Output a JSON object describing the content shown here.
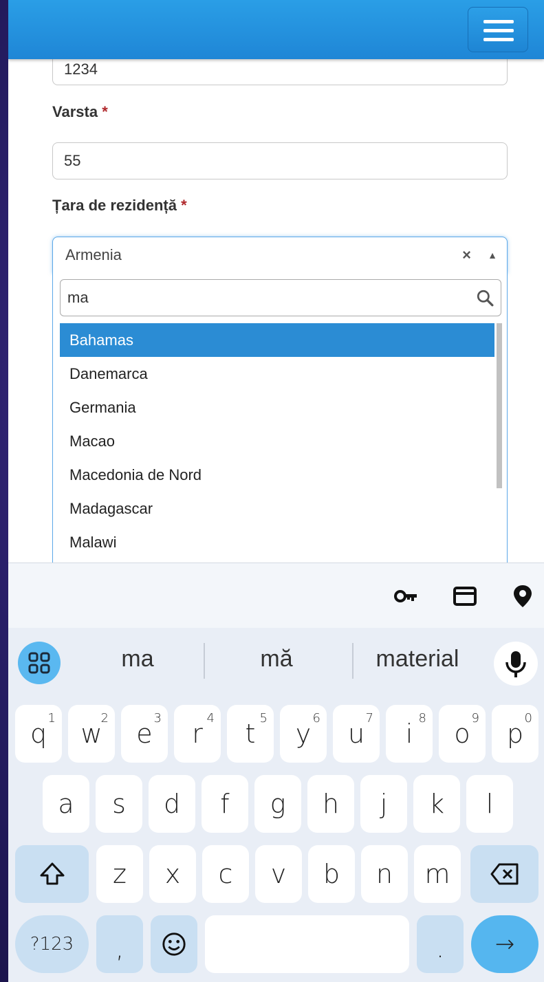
{
  "form": {
    "top_field_value": "1234",
    "age_label": "Varsta",
    "age_value": "55",
    "country_label": "Țara de rezidență",
    "required_mark": "*",
    "country_selected": "Armenia",
    "clear_symbol": "×",
    "arrow_symbol": "▲"
  },
  "dropdown": {
    "search_value": "ma",
    "options": [
      "Bahamas",
      "Danemarca",
      "Germania",
      "Macao",
      "Macedonia de Nord",
      "Madagascar",
      "Malawi"
    ],
    "active_index": 0
  },
  "keyboard": {
    "suggestions": [
      "ma",
      "mă",
      "material"
    ],
    "row1": [
      "q",
      "w",
      "e",
      "r",
      "t",
      "y",
      "u",
      "i",
      "o",
      "p"
    ],
    "row1_nums": [
      "1",
      "2",
      "3",
      "4",
      "5",
      "6",
      "7",
      "8",
      "9",
      "0"
    ],
    "row2": [
      "a",
      "s",
      "d",
      "f",
      "g",
      "h",
      "j",
      "k",
      "l"
    ],
    "row3": [
      "z",
      "x",
      "c",
      "v",
      "b",
      "n",
      "m"
    ],
    "symbols_label": "?123",
    "comma_label": ",",
    "period_label": ".",
    "enter_label": "→"
  },
  "colors": {
    "header": "#1f86d6",
    "active_option": "#2b8cd4",
    "required": "#b0282c",
    "enter_key": "#55b6ef"
  }
}
